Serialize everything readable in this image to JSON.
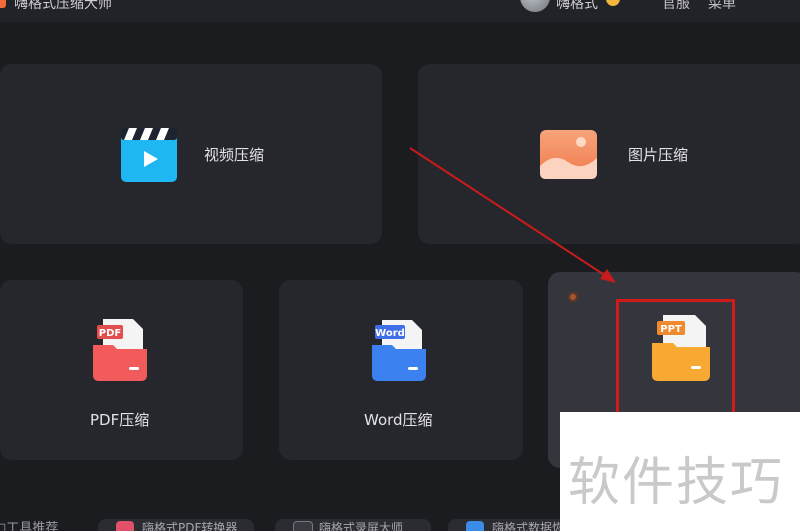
{
  "header": {
    "app_title": "嗨格式压缩大师",
    "username": "嗨格式",
    "nav": {
      "official": "官服",
      "menu": "菜单"
    }
  },
  "cards": {
    "video": {
      "label": "视频压缩",
      "icon": "video-play-icon"
    },
    "image": {
      "label": "图片压缩",
      "icon": "image-landscape-icon"
    },
    "pdf": {
      "label": "PDF压缩",
      "icon": "pdf-folder-icon",
      "badge": "PDF"
    },
    "word": {
      "label": "Word压缩",
      "icon": "word-folder-icon",
      "badge": "Word"
    },
    "ppt": {
      "label": "",
      "icon": "ppt-folder-icon",
      "badge": "PPT"
    }
  },
  "recommend": {
    "title": "□工具推荐",
    "items": [
      {
        "label": "嗨格式PDF转换器",
        "color": "#e2506a"
      },
      {
        "label": "嗨格式录屏大师",
        "color": "#3a3b42"
      },
      {
        "label": "嗨格式数据恢复",
        "color": "#3a8ce8"
      }
    ]
  },
  "watermark": {
    "text": "软件技巧"
  },
  "colors": {
    "background": "#1b1c20",
    "card": "#26272c",
    "card_active": "#34353d",
    "accent_red": "#d11a1a"
  }
}
